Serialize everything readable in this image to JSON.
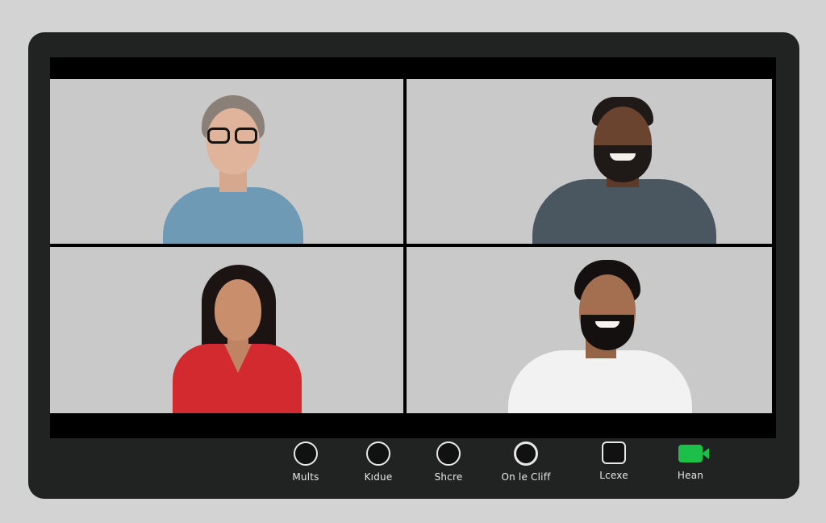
{
  "participants": [
    {
      "id": "p1",
      "shirt_color": "#6f9ab5",
      "skin": "#e0b49a",
      "hair": "#8a8078",
      "glasses": true
    },
    {
      "id": "p2",
      "shirt_color": "#4a5660",
      "skin": "#6b4430",
      "hair": "#1f1a17",
      "beard": true
    },
    {
      "id": "p3",
      "shirt_color": "#d22a2e",
      "skin": "#c98f6d",
      "hair": "#1c1412"
    },
    {
      "id": "p4",
      "shirt_color": "#f2f2f2",
      "skin": "#a36f50",
      "hair": "#141010",
      "beard": true
    }
  ],
  "controls": [
    {
      "label": "Mults",
      "icon": "circle-icon"
    },
    {
      "label": "Kıdue",
      "icon": "circle-icon"
    },
    {
      "label": "Shcre",
      "icon": "circle-icon"
    },
    {
      "label": "On le Cliff",
      "icon": "circle-icon"
    },
    {
      "label": "Lcexe",
      "icon": "square-icon"
    },
    {
      "label": "Hean",
      "icon": "video-camera-icon",
      "color": "#1bbf4a"
    }
  ]
}
